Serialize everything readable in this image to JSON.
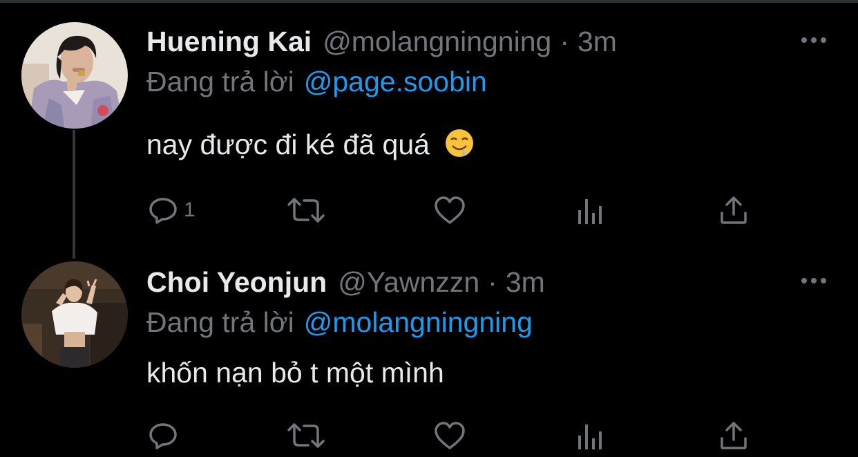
{
  "colors": {
    "background": "#000000",
    "primary_text": "#e7e9ea",
    "secondary_text": "#71767b",
    "accent": "#1d9bf0",
    "thread_line": "#333639"
  },
  "tweets": [
    {
      "display_name": "Huening Kai",
      "handle": "@molangningning",
      "separator": "·",
      "time": "3m",
      "reply_prefix": "Đang trả lời",
      "reply_to": "@page.soobin",
      "text": "nay được đi ké đã quá",
      "emoji": "drooling-face-icon",
      "reply_count": "1",
      "icons": [
        "reply-icon",
        "retweet-icon",
        "like-icon",
        "analytics-icon",
        "share-icon",
        "more-options-icon"
      ]
    },
    {
      "display_name": "Choi Yeonjun",
      "handle": "@Yawnzzn",
      "separator": "·",
      "time": "3m",
      "reply_prefix": "Đang trả lời",
      "reply_to": "@molangningning",
      "text": "khốn nạn bỏ t một mình",
      "reply_count": "",
      "icons": [
        "reply-icon",
        "retweet-icon",
        "like-icon",
        "analytics-icon",
        "share-icon",
        "more-options-icon"
      ]
    }
  ]
}
